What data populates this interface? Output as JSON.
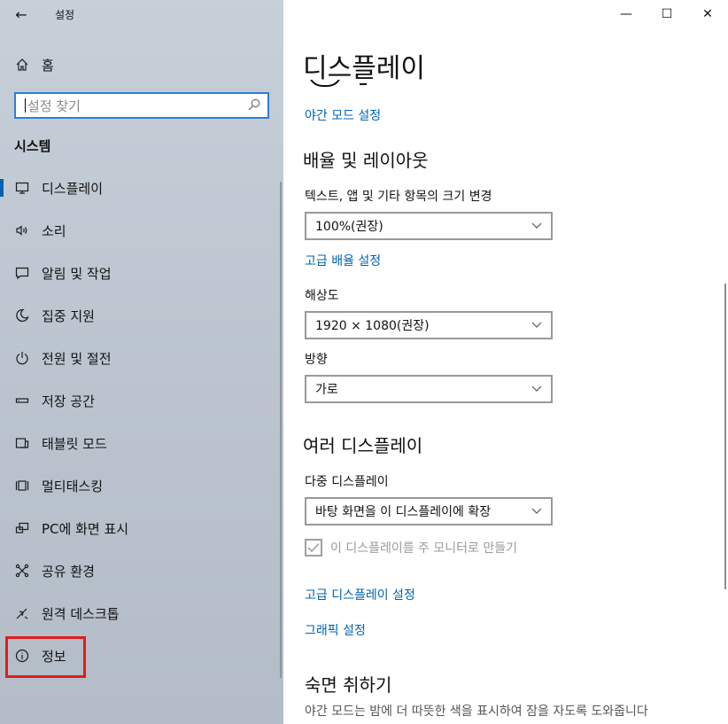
{
  "window": {
    "app_title": "설정",
    "back_icon": "arrow-left-icon",
    "controls": {
      "minimize": "—",
      "maximize": "☐",
      "close": "✕"
    }
  },
  "sidebar": {
    "home_label": "홈",
    "search_placeholder": "설정 찾기",
    "section_title": "시스템",
    "items": [
      {
        "label": "디스플레이",
        "icon": "monitor-icon",
        "active": true
      },
      {
        "label": "소리",
        "icon": "speaker-icon"
      },
      {
        "label": "알림 및 작업",
        "icon": "notification-icon"
      },
      {
        "label": "집중 지원",
        "icon": "moon-icon"
      },
      {
        "label": "전원 및 절전",
        "icon": "power-icon"
      },
      {
        "label": "저장 공간",
        "icon": "storage-icon"
      },
      {
        "label": "태블릿 모드",
        "icon": "tablet-icon"
      },
      {
        "label": "멀티태스킹",
        "icon": "multitasking-icon"
      },
      {
        "label": "PC에 화면 표시",
        "icon": "project-icon"
      },
      {
        "label": "공유 환경",
        "icon": "share-icon"
      },
      {
        "label": "원격 데스크톱",
        "icon": "remote-icon"
      },
      {
        "label": "정보",
        "icon": "info-icon"
      }
    ]
  },
  "main": {
    "title": "디스플레이",
    "night_link": "야간 모드 설정",
    "scale_layout": {
      "heading": "배율 및 레이아웃",
      "scale_label": "텍스트, 앱 및 기타 항목의 크기 변경",
      "scale_value": "100%(권장)",
      "advanced_scale_link": "고급 배율 설정",
      "resolution_label": "해상도",
      "resolution_value": "1920 × 1080(권장)",
      "orientation_label": "방향",
      "orientation_value": "가로"
    },
    "multi": {
      "heading": "여러 디스플레이",
      "multi_label": "다중 디스플레이",
      "multi_value": "바탕 화면을 이 디스플레이에 확장",
      "main_checkbox_label": "이 디스플레이를 주 모니터로 만들기",
      "advanced_display_link": "고급 디스플레이 설정",
      "graphics_link": "그래픽 설정"
    },
    "sleep": {
      "heading": "숙면 취하기",
      "description": "야간 모드는 밤에 더 따뜻한 색을 표시하여 잠을 자도록 도와줍니다"
    }
  },
  "colors": {
    "accent": "#0063b1",
    "highlight": "#e31b1b",
    "sidebar_bg": "#bfc7d1"
  }
}
